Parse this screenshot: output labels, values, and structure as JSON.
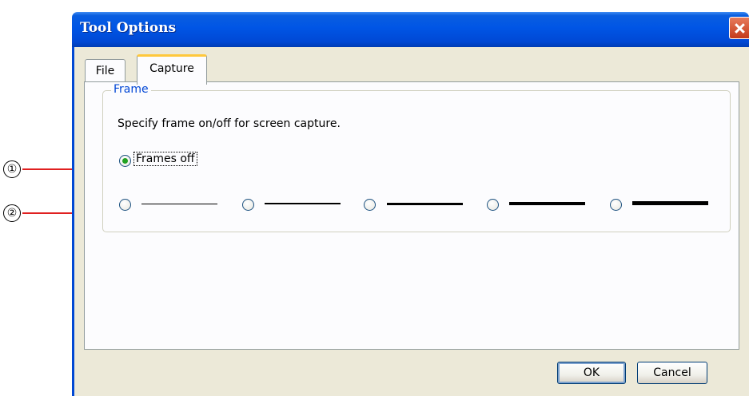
{
  "callouts": [
    {
      "label": "①"
    },
    {
      "label": "②"
    }
  ],
  "window": {
    "title": "Tool Options"
  },
  "tabs": [
    {
      "label": "File",
      "active": false
    },
    {
      "label": "Capture",
      "active": true
    }
  ],
  "frame_group": {
    "legend": "Frame",
    "description": "Specify frame on/off for screen capture.",
    "frames_off_label": "Frames off",
    "selected_option": "Frames off",
    "line_thickness_options": 5
  },
  "buttons": {
    "ok": "OK",
    "cancel": "Cancel"
  },
  "colors": {
    "title_bar": "#0055e5",
    "close_button": "#d9542f",
    "dialog_background": "#ece9d8",
    "tab_highlight": "#ffc83c",
    "group_legend": "#0046d5",
    "selected_radio": "#21a121",
    "callout_line": "#e02020"
  }
}
